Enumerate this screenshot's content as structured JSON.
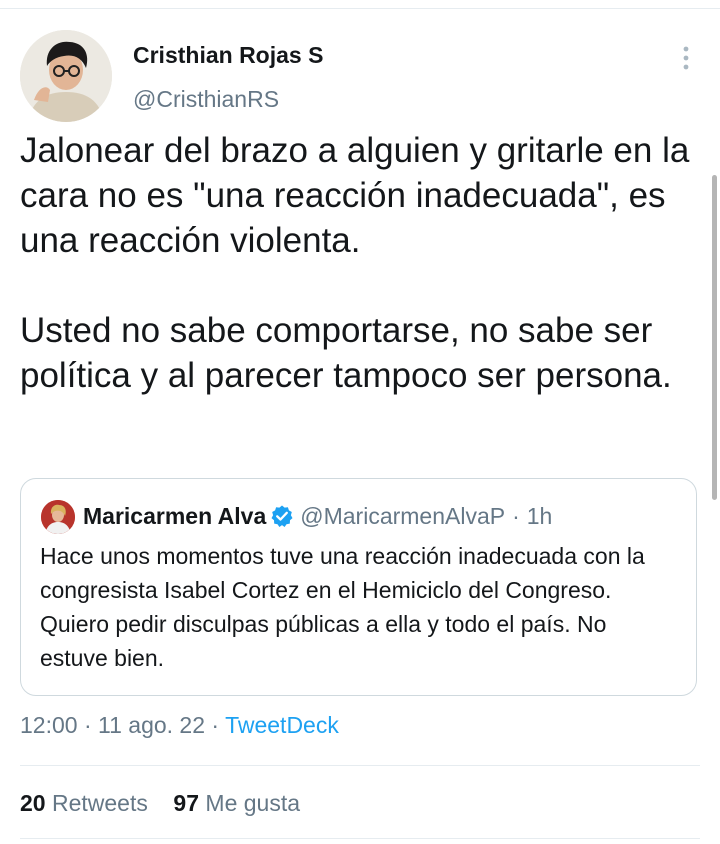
{
  "author": {
    "display_name": "Cristhian Rojas S",
    "handle": "@CristhianRS"
  },
  "tweet": {
    "paragraphs": [
      "Jalonear del brazo a alguien y gritarle en la cara no es \"una reacción inadecuada\", es una reacción violenta.",
      "Usted no sabe comportarse, no sabe ser política y al parecer tampoco ser persona."
    ]
  },
  "quoted_tweet": {
    "display_name": "Maricarmen Alva",
    "verified": true,
    "handle": "@MaricarmenAlvaP",
    "separator": "·",
    "time": "1h",
    "text": "Hace unos momentos tuve una reacción inadecuada con la congresista Isabel Cortez en el Hemiciclo del Congreso. Quiero pedir disculpas públicas a ella y todo el país. No estuve bien."
  },
  "meta": {
    "time": "12:00",
    "separator": "·",
    "date": "11 ago. 22",
    "source": "TweetDeck"
  },
  "stats": {
    "retweets_count": "20",
    "retweets_label": "Retweets",
    "likes_count": "97",
    "likes_label": "Me gusta"
  },
  "icons": {
    "more": "more-vertical-icon",
    "verified": "verified-badge-icon"
  },
  "colors": {
    "text": "#14171a",
    "secondary": "#657786",
    "link": "#1da1f2",
    "border": "#cfd9de"
  }
}
